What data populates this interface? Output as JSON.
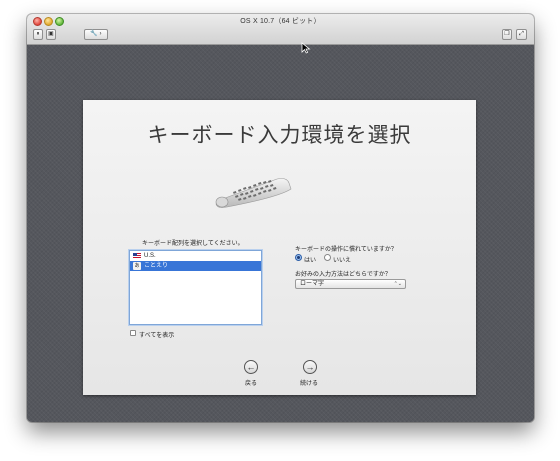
{
  "window": {
    "title": "OS X 10.7（64 ビット）"
  },
  "toolbar": {
    "buttons": [
      {
        "icon": "pause-icon",
        "glyph": "⏸"
      },
      {
        "icon": "screenshot-icon",
        "glyph": "▣"
      },
      {
        "icon": "wrench-icon",
        "glyph": "🔧 ›"
      }
    ],
    "right_buttons": [
      {
        "icon": "duplicate-icon",
        "glyph": "❐"
      },
      {
        "icon": "fullscreen-icon",
        "glyph": "⤢"
      }
    ]
  },
  "setup": {
    "title": "キーボード入力環境を選択",
    "layout_prompt": "キーボード配列を選択してください。",
    "layouts": [
      {
        "label": "U.S.",
        "icon": "us-flag-icon",
        "selected": false
      },
      {
        "label": "ことえり",
        "icon": "kotoeri-icon",
        "badge": "あ",
        "selected": true
      }
    ],
    "show_all_label": "すべてを表示",
    "familiar_question": "キーボードの操作に慣れていますか？",
    "yes_label": "はい",
    "no_label": "いいえ",
    "input_method_question": "お好みの入力方法はどちらですか？",
    "input_method_value": "ローマ字",
    "back_label": "戻る",
    "continue_label": "続ける",
    "back_glyph": "←",
    "continue_glyph": "→",
    "popup_glyph": "⌃⌄"
  }
}
